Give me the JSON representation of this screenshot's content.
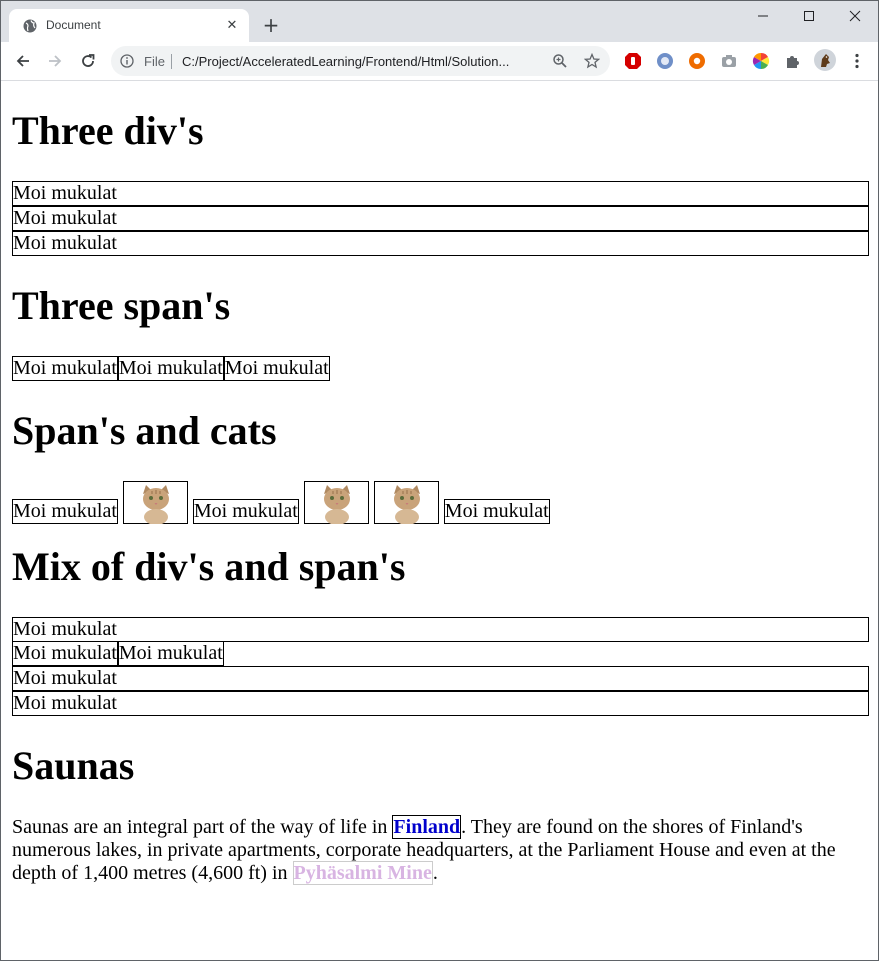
{
  "browser": {
    "tab_title": "Document",
    "scheme_label": "File",
    "url": "C:/Project/AcceleratedLearning/Frontend/Html/Solution..."
  },
  "page": {
    "heading_divs": "Three div's",
    "div_text": "Moi mukulat",
    "heading_spans": "Three span's",
    "heading_cats": "Span's and cats",
    "heading_mix": "Mix of div's and span's",
    "heading_saunas": "Saunas",
    "sauna_text_1": "Saunas are an integral part of the way of life in ",
    "sauna_link_1": "Finland",
    "sauna_text_2": ". They are found on the shores of Finland's numerous lakes, in private apartments, corporate headquarters, at the Parliament House and even at the depth of 1,400 metres (4,600 ft) in ",
    "sauna_link_2": "Pyhäsalmi Mine",
    "sauna_text_3": "."
  },
  "colors": {
    "chrome_tabbar": "#dee1e6",
    "link_finland": "#0000cc",
    "link_mine": "#d8b4e2"
  },
  "icons": [
    "globe-icon",
    "close-icon",
    "plus-icon",
    "minimize-icon",
    "maximize-icon",
    "window-close-icon",
    "back-arrow-icon",
    "forward-arrow-icon",
    "reload-icon",
    "info-icon",
    "zoom-icon",
    "star-icon",
    "extension-icons",
    "puzzle-icon",
    "profile-avatar",
    "kebab-menu-icon",
    "cat-image"
  ]
}
